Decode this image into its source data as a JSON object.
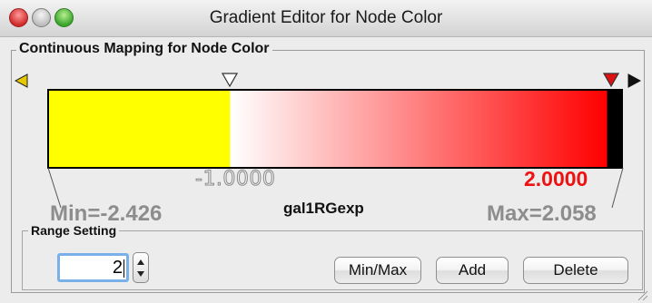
{
  "window": {
    "title": "Gradient Editor for Node Color"
  },
  "panel": {
    "title": "Continuous Mapping for Node Color"
  },
  "gradient": {
    "left_point_value": "-1.0000",
    "right_point_value": "2.0000",
    "min_label": "Min=-2.426",
    "max_label": "Max=2.058",
    "attribute_name": "gal1RGexp",
    "colors": {
      "below": "#ffff00",
      "mid": "#ffffff",
      "high": "#ff0000",
      "above": "#000000",
      "selected_handle": "#dd1111",
      "edge_arrow_left": "#e6c800"
    }
  },
  "range_setting": {
    "title": "Range Setting",
    "value": "2",
    "buttons": {
      "min_max": "Min/Max",
      "add": "Add",
      "delete": "Delete"
    }
  },
  "icons": {
    "close": "close-icon",
    "minimize": "minimize-icon",
    "zoom": "zoom-icon",
    "left_edge": "left-edge-triangle-icon",
    "right_edge": "right-edge-triangle-icon",
    "handle_neutral": "handle-triangle-icon",
    "handle_selected": "handle-triangle-selected-icon",
    "stepper_up": "stepper-up-icon",
    "stepper_down": "stepper-down-icon",
    "resize": "resize-grip-icon"
  }
}
